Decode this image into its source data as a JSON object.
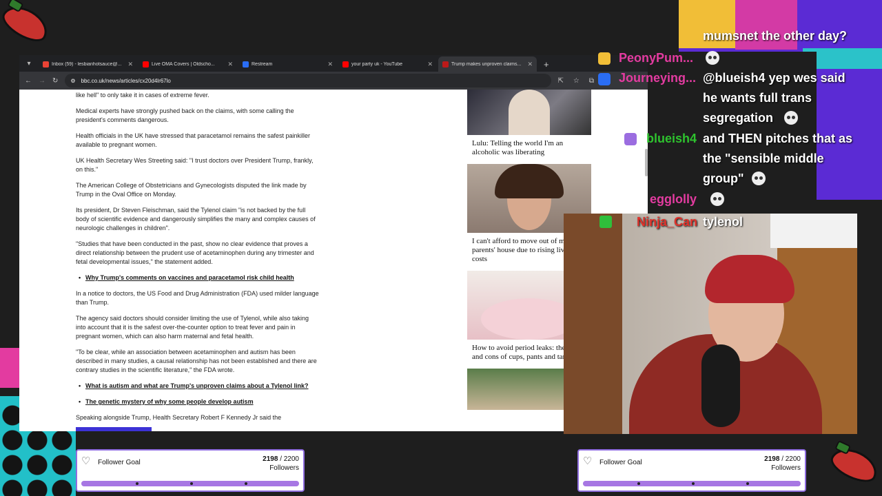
{
  "browser": {
    "tabs": [
      {
        "title": "Inbox (59) - lesbianhotsauce@...",
        "color": "#ea4335"
      },
      {
        "title": "Live OMA Covers | Oldscho...",
        "color": "#ff0000"
      },
      {
        "title": "Restream",
        "color": "#2a6df4"
      },
      {
        "title": "your party uk - YouTube",
        "color": "#ff0000"
      },
      {
        "title": "Trump makes unproven claims...",
        "color": "#bb1919",
        "active": true
      }
    ],
    "url": "bbc.co.uk/news/articles/cx20d4lr67lo"
  },
  "article": {
    "paragraphs": [
      {
        "text": "like hell\" to only take it in cases of extreme fever."
      },
      {
        "text": "Medical experts have strongly pushed back on the claims, with some calling the president's comments dangerous."
      },
      {
        "text": "Health officials in the UK have stressed that paracetamol remains the safest painkiller available to pregnant women."
      },
      {
        "text": "UK Health Secretary Wes Streeting said: \"I trust doctors over President Trump, frankly, on this.\""
      },
      {
        "text": "The American College of Obstetricians and Gynecologists disputed the link made by Trump in the Oval Office on Monday."
      },
      {
        "text": "Its president, Dr Steven Fleischman, said the Tylenol claim \"is not backed by the full body of scientific evidence and dangerously simplifies the many and complex causes of neurologic challenges in children\"."
      },
      {
        "text": "\"Studies that have been conducted in the past, show no clear evidence that proves a direct relationship between the prudent use of acetaminophen during any trimester and fetal developmental issues,\" the statement added."
      },
      {
        "text": "Why Trump's comments on vaccines and paracetamol risk child health",
        "link": true
      },
      {
        "text": "In a notice to doctors, the US Food and Drug Administration (FDA) used milder language than Trump."
      },
      {
        "text": "The agency said doctors should consider limiting the use of Tylenol, while also taking into account that it is the safest over-the-counter option to treat fever and pain in pregnant women, which can also harm maternal and fetal health."
      },
      {
        "text": "\"To be clear, while an association between acetaminophen and autism has been described in many studies, a causal relationship has not been established and there are contrary studies in the scientific literature,\" the FDA wrote."
      },
      {
        "text": "What is autism and what are Trump's unproven claims about a Tylenol link?",
        "link": true
      },
      {
        "text": "The genetic mystery of why some people develop autism",
        "link": true
      },
      {
        "text": "Speaking alongside Trump, Health Secretary Robert F Kennedy Jr said the"
      }
    ]
  },
  "sidebar": {
    "cards": [
      {
        "title": "Lulu: Telling the world I'm an alcoholic was liberating"
      },
      {
        "title": "I can't afford to move out of my parents' house due to rising living costs"
      },
      {
        "title": "How to avoid period leaks: the pros and cons of cups, pants and tampons"
      },
      {
        "title": ""
      }
    ]
  },
  "chat": {
    "messages": [
      {
        "user": "",
        "text": "mumsnet the other day?"
      },
      {
        "user": "PeonyPum...",
        "user_color": "#e33ba0",
        "text": ""
      },
      {
        "user": "Journeying...",
        "user_color": "#e33ba0",
        "text": "@blueish4 yep wes said he wants full trans segregation"
      },
      {
        "user": "blueish4",
        "user_color": "#2ec22e",
        "text": "and THEN pitches that as the \"sensible middle group\""
      },
      {
        "user": "egglolly",
        "user_color": "#e33ba0",
        "text": ""
      }
    ],
    "cam_message": {
      "user": "Ninja_Can",
      "text": "tylenol"
    }
  },
  "follower_goal": {
    "label": "Follower Goal",
    "current": "2198",
    "separator": "/",
    "target": "2200",
    "unit": "Followers",
    "progress": 0.999
  }
}
